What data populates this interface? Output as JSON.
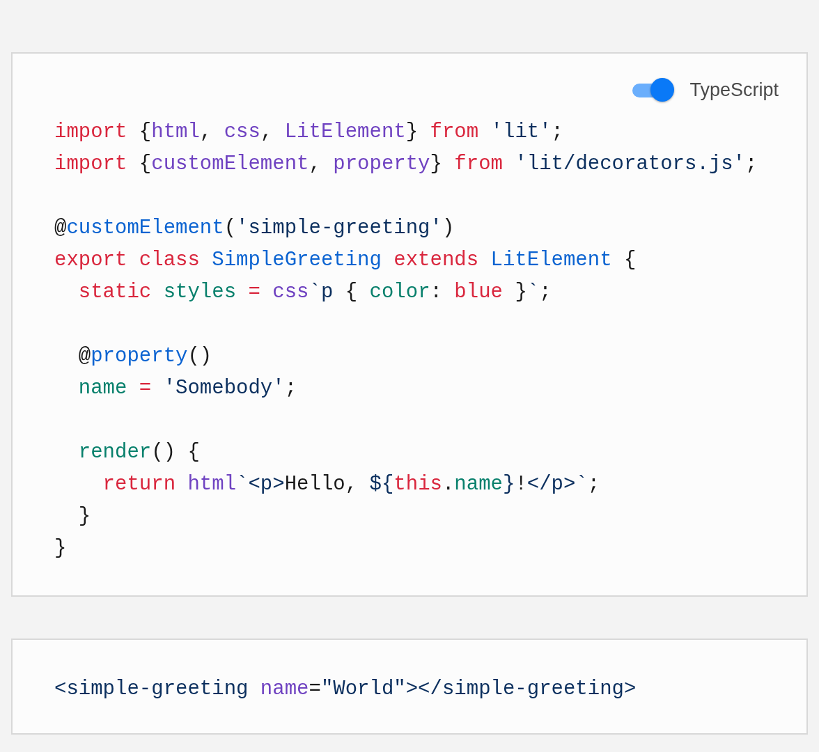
{
  "typescript_toggle": {
    "label": "TypeScript",
    "on": true
  },
  "code_blocks": [
    [
      [
        {
          "kind": "kw",
          "text": "import"
        },
        {
          "kind": "plain",
          "text": " {"
        },
        {
          "kind": "fn",
          "text": "html"
        },
        {
          "kind": "plain",
          "text": ", "
        },
        {
          "kind": "fn",
          "text": "css"
        },
        {
          "kind": "plain",
          "text": ", "
        },
        {
          "kind": "fn",
          "text": "LitElement"
        },
        {
          "kind": "plain",
          "text": "} "
        },
        {
          "kind": "kw",
          "text": "from"
        },
        {
          "kind": "str",
          "text": " 'lit'"
        },
        {
          "kind": "plain",
          "text": ";"
        }
      ],
      [
        {
          "kind": "kw",
          "text": "import"
        },
        {
          "kind": "plain",
          "text": " {"
        },
        {
          "kind": "fn",
          "text": "customElement"
        },
        {
          "kind": "plain",
          "text": ", "
        },
        {
          "kind": "fn",
          "text": "property"
        },
        {
          "kind": "plain",
          "text": "} "
        },
        {
          "kind": "kw",
          "text": "from"
        },
        {
          "kind": "str",
          "text": " 'lit/decorators.js'"
        },
        {
          "kind": "plain",
          "text": ";"
        }
      ]
    ],
    [
      [
        {
          "kind": "plain",
          "text": "@"
        },
        {
          "kind": "ent",
          "text": "customElement"
        },
        {
          "kind": "plain",
          "text": "("
        },
        {
          "kind": "str",
          "text": "'simple-greeting'"
        },
        {
          "kind": "plain",
          "text": ")"
        }
      ],
      [
        {
          "kind": "kw",
          "text": "export class "
        },
        {
          "kind": "ent",
          "text": "SimpleGreeting "
        },
        {
          "kind": "kw",
          "text": "extends "
        },
        {
          "kind": "ent",
          "text": "LitElement"
        },
        {
          "kind": "plain",
          "text": " {"
        }
      ],
      [
        {
          "kind": "kw",
          "text": "  static "
        },
        {
          "kind": "prop",
          "text": "styles "
        },
        {
          "kind": "kw",
          "text": "= "
        },
        {
          "kind": "fn",
          "text": "css"
        },
        {
          "kind": "str",
          "text": "`p"
        },
        {
          "kind": "plain",
          "text": " { "
        },
        {
          "kind": "prop",
          "text": "color"
        },
        {
          "kind": "plain",
          "text": ": "
        },
        {
          "kind": "kw",
          "text": "blue"
        },
        {
          "kind": "plain",
          "text": " }"
        },
        {
          "kind": "str",
          "text": "`"
        },
        {
          "kind": "plain",
          "text": ";"
        }
      ]
    ],
    [
      [
        {
          "kind": "plain",
          "text": "  @"
        },
        {
          "kind": "ent",
          "text": "property"
        },
        {
          "kind": "plain",
          "text": "()"
        }
      ],
      [
        {
          "kind": "prop",
          "text": "  name "
        },
        {
          "kind": "kw",
          "text": "= "
        },
        {
          "kind": "str",
          "text": "'Somebody'"
        },
        {
          "kind": "plain",
          "text": ";"
        }
      ]
    ],
    [
      [
        {
          "kind": "prop",
          "text": "  render"
        },
        {
          "kind": "plain",
          "text": "() {"
        }
      ],
      [
        {
          "kind": "kw",
          "text": "    return "
        },
        {
          "kind": "fn",
          "text": "html"
        },
        {
          "kind": "str",
          "text": "`<p>"
        },
        {
          "kind": "plain",
          "text": "Hello, "
        },
        {
          "kind": "str",
          "text": "${"
        },
        {
          "kind": "kw",
          "text": "this"
        },
        {
          "kind": "plain",
          "text": "."
        },
        {
          "kind": "prop",
          "text": "name"
        },
        {
          "kind": "str",
          "text": "}"
        },
        {
          "kind": "plain",
          "text": "!"
        },
        {
          "kind": "str",
          "text": "</p>`"
        },
        {
          "kind": "plain",
          "text": ";"
        }
      ],
      [
        {
          "kind": "plain",
          "text": "  }"
        }
      ],
      [
        {
          "kind": "plain",
          "text": "}"
        }
      ]
    ]
  ],
  "usage_code": [
    [
      {
        "kind": "str",
        "text": "<simple-greeting "
      },
      {
        "kind": "fn",
        "text": "name"
      },
      {
        "kind": "plain",
        "text": "="
      },
      {
        "kind": "str",
        "text": "\"World\""
      },
      {
        "kind": "str",
        "text": "></simple-greeting>"
      }
    ]
  ]
}
